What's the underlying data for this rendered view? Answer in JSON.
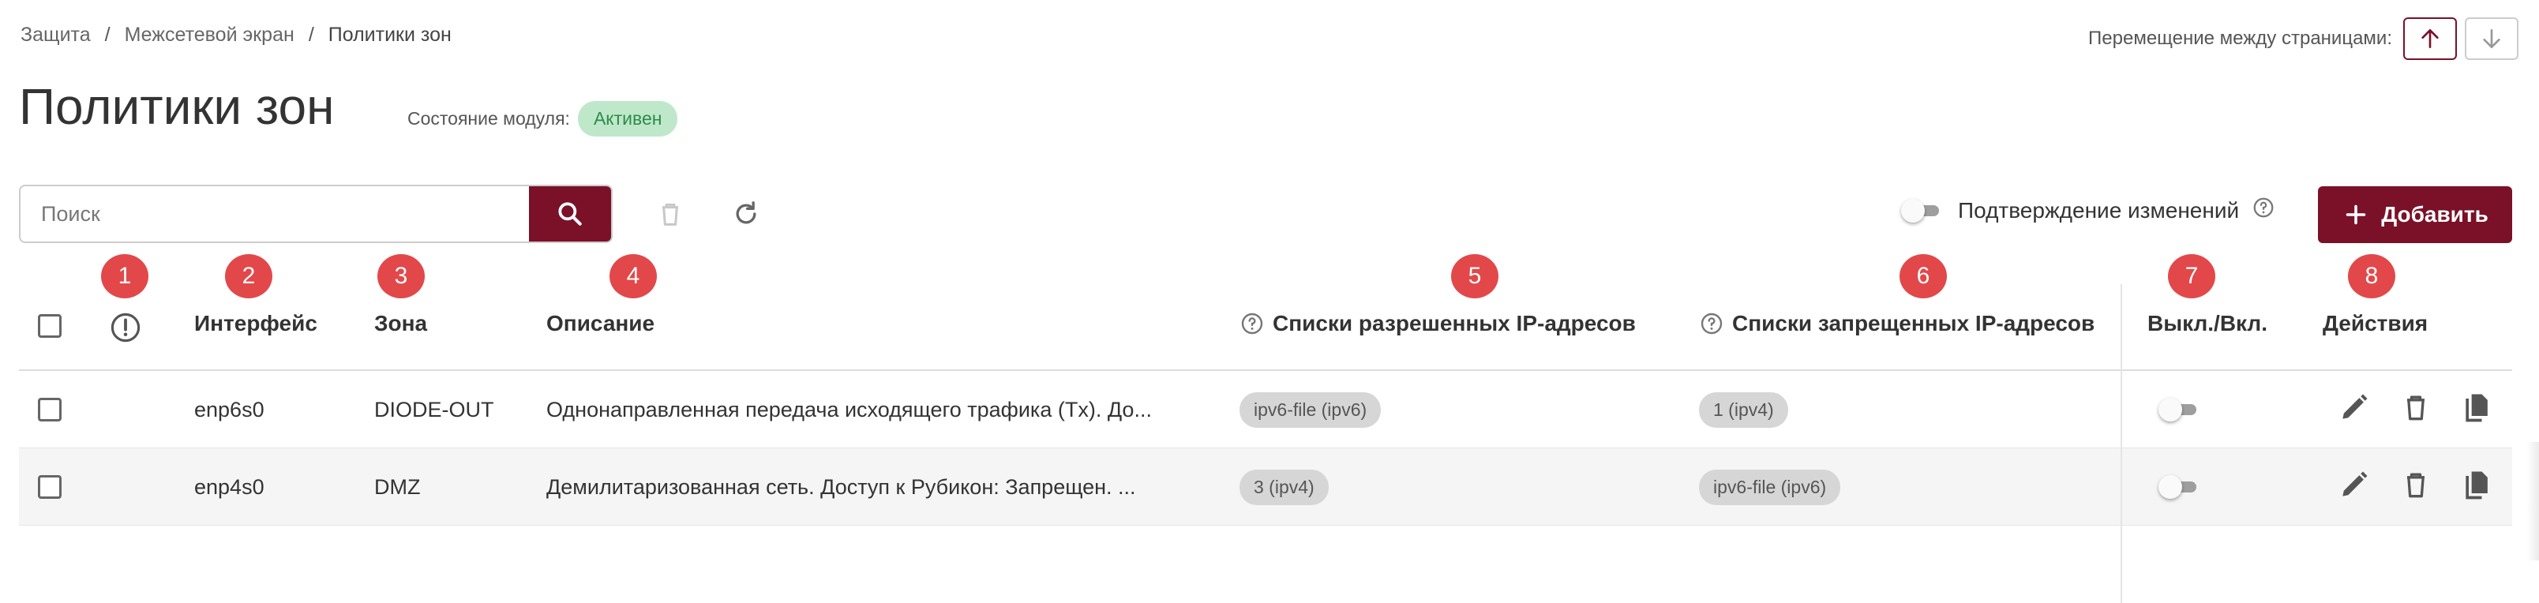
{
  "breadcrumb": [
    "Защита",
    "Межсетевой экран",
    "Политики зон"
  ],
  "page_nav": {
    "label": "Перемещение между страницами:",
    "up_icon": "arrow-up-icon",
    "down_icon": "arrow-down-icon"
  },
  "title": "Политики зон",
  "module_status": {
    "label": "Состояние модуля:",
    "value": "Активен"
  },
  "search": {
    "placeholder": "Поиск"
  },
  "confirm_label": "Подтверждение изменений",
  "add_label": "Добавить",
  "markers": [
    "1",
    "2",
    "3",
    "4",
    "5",
    "6",
    "7",
    "8"
  ],
  "columns": {
    "interface": "Интерфейс",
    "zone": "Зона",
    "description": "Описание",
    "allowed": "Списки разрешенных IP-адресов",
    "denied": "Списки запрещенных IP-адресов",
    "toggle": "Выкл./Вкл.",
    "actions": "Действия"
  },
  "rows": [
    {
      "interface": "enp6s0",
      "zone": "DIODE-OUT",
      "description": "Однонаправленная передача исходящего трафика (Tx). До...",
      "allowed": "ipv6-file (ipv6)",
      "denied": "1 (ipv4)",
      "enabled": false
    },
    {
      "interface": "enp4s0",
      "zone": "DMZ",
      "description": "Демилитаризованная сеть. Доступ к Рубикон: Запрещен. ...",
      "allowed": "3 (ipv4)",
      "denied": "ipv6-file (ipv6)",
      "enabled": false
    }
  ],
  "colors": {
    "accent": "#7a1128",
    "badge_bg": "#bfe8cb",
    "badge_text": "#2e8b4a",
    "marker": "#e2484a"
  }
}
